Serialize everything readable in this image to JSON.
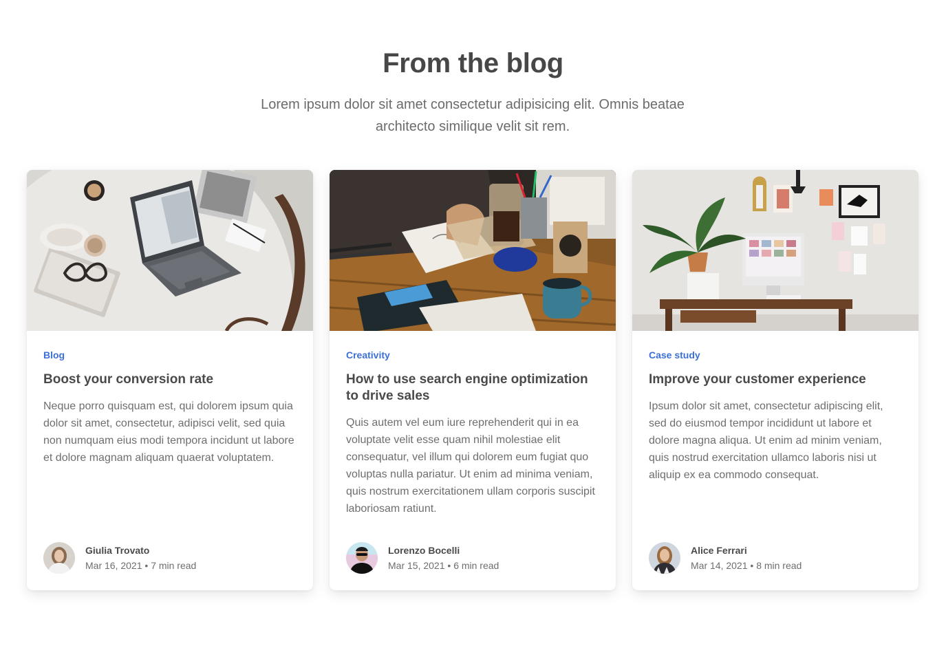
{
  "section": {
    "title": "From the blog",
    "subtitle": "Lorem ipsum dolor sit amet consectetur adipisicing elit. Omnis beatae architecto similique velit sit rem."
  },
  "posts": [
    {
      "category": "Blog",
      "title": "Boost your conversion rate",
      "excerpt": "Neque porro quisquam est, qui dolorem ipsum quia dolor sit amet, consectetur, adipisci velit, sed quia non numquam eius modi tempora incidunt ut labore et dolore magnam aliquam quaerat voluptatem.",
      "author": "Giulia Trovato",
      "date": "Mar 16, 2021",
      "separator": "•",
      "read_time": "7 min read",
      "image_icon": "laptop-desk-photo"
    },
    {
      "category": "Creativity",
      "title": "How to use search engine optimization to drive sales",
      "excerpt": "Quis autem vel eum iure reprehenderit qui in ea voluptate velit esse quam nihil molestiae elit consequatur, vel illum qui dolorem eum fugiat quo voluptas nulla pariatur. Ut enim ad minima veniam, quis nostrum exercitationem ullam corporis suscipit laboriosam ratiunt.",
      "author": "Lorenzo Bocelli",
      "date": "Mar 15, 2021",
      "separator": "•",
      "read_time": "6 min read",
      "image_icon": "sketching-desk-photo"
    },
    {
      "category": "Case study",
      "title": "Improve your customer experience",
      "excerpt": "Ipsum dolor sit amet, consectetur adipiscing elit, sed do eiusmod tempor incididunt ut labore et dolore magna aliqua. Ut enim ad minim veniam, quis nostrud exercitation ullamco laboris nisi ut aliquip ex ea commodo consequat.",
      "author": "Alice Ferrari",
      "date": "Mar 14, 2021",
      "separator": "•",
      "read_time": "8 min read",
      "image_icon": "home-office-photo"
    }
  ],
  "colors": {
    "accent": "#3b6fd6",
    "heading": "#474747",
    "body_text": "#6e6e6e"
  }
}
